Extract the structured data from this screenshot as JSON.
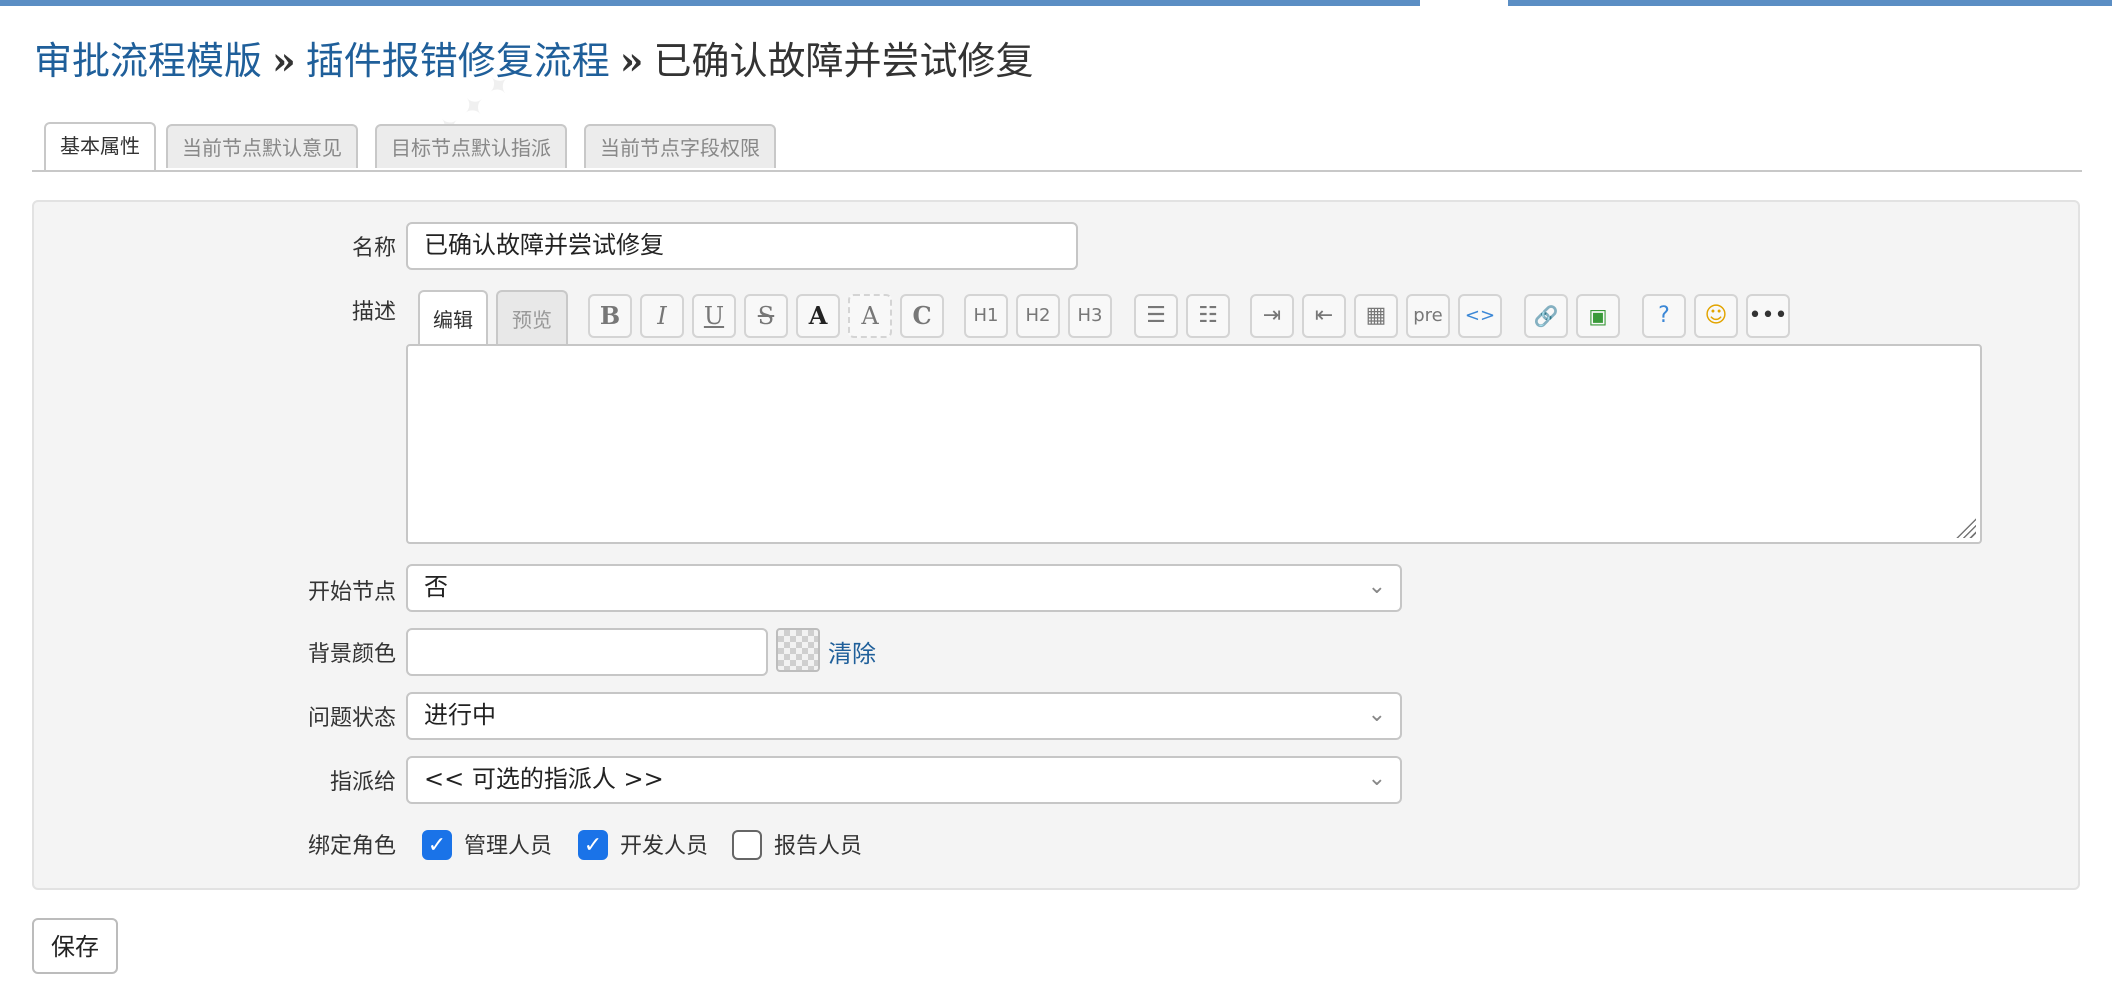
{
  "breadcrumb": {
    "item1": "审批流程模版",
    "item2": "插件报错修复流程",
    "separator": "»",
    "current": "已确认故障并尝试修复"
  },
  "tabs": [
    {
      "label": "基本属性",
      "active": true
    },
    {
      "label": "当前节点默认意见",
      "active": false
    },
    {
      "label": "目标节点默认指派",
      "active": false
    },
    {
      "label": "当前节点字段权限",
      "active": false
    }
  ],
  "form": {
    "name_label": "名称",
    "name_value": "已确认故障并尝试修复",
    "desc_label": "描述",
    "editor_tab_edit": "编辑",
    "editor_tab_preview": "预览",
    "toolbar": {
      "bold": "B",
      "italic": "I",
      "underline": "U",
      "strike": "S",
      "fontcolor": "A",
      "bgcolor": "A",
      "code": "C",
      "h1": "H1",
      "h2": "H2",
      "h3": "H3",
      "pre": "pre",
      "source": "<>",
      "icons": [
        "bold-icon",
        "italic-icon",
        "underline-icon",
        "strikethrough-icon",
        "font-color-icon",
        "background-color-icon",
        "inline-code-icon",
        "h1-icon",
        "h2-icon",
        "h3-icon",
        "bullet-list-icon",
        "numbered-list-icon",
        "indent-icon",
        "outdent-icon",
        "table-icon",
        "pre-icon",
        "source-code-icon",
        "link-icon",
        "image-icon",
        "help-icon",
        "emoji-icon",
        "more-icon"
      ]
    },
    "start_node_label": "开始节点",
    "start_node_value": "否",
    "bg_color_label": "背景颜色",
    "bg_color_value": "",
    "clear_label": "清除",
    "status_label": "问题状态",
    "status_value": "进行中",
    "assign_label": "指派给",
    "assign_value": "<< 可选的指派人 >>",
    "roles_label": "绑定角色",
    "roles": [
      {
        "label": "管理人员",
        "checked": true
      },
      {
        "label": "开发人员",
        "checked": true
      },
      {
        "label": "报告人员",
        "checked": false
      }
    ]
  },
  "save_label": "保存",
  "colors": {
    "accent": "#1f5f9a",
    "topbar": "#5b8ec4",
    "checkbox": "#1a73e8"
  }
}
